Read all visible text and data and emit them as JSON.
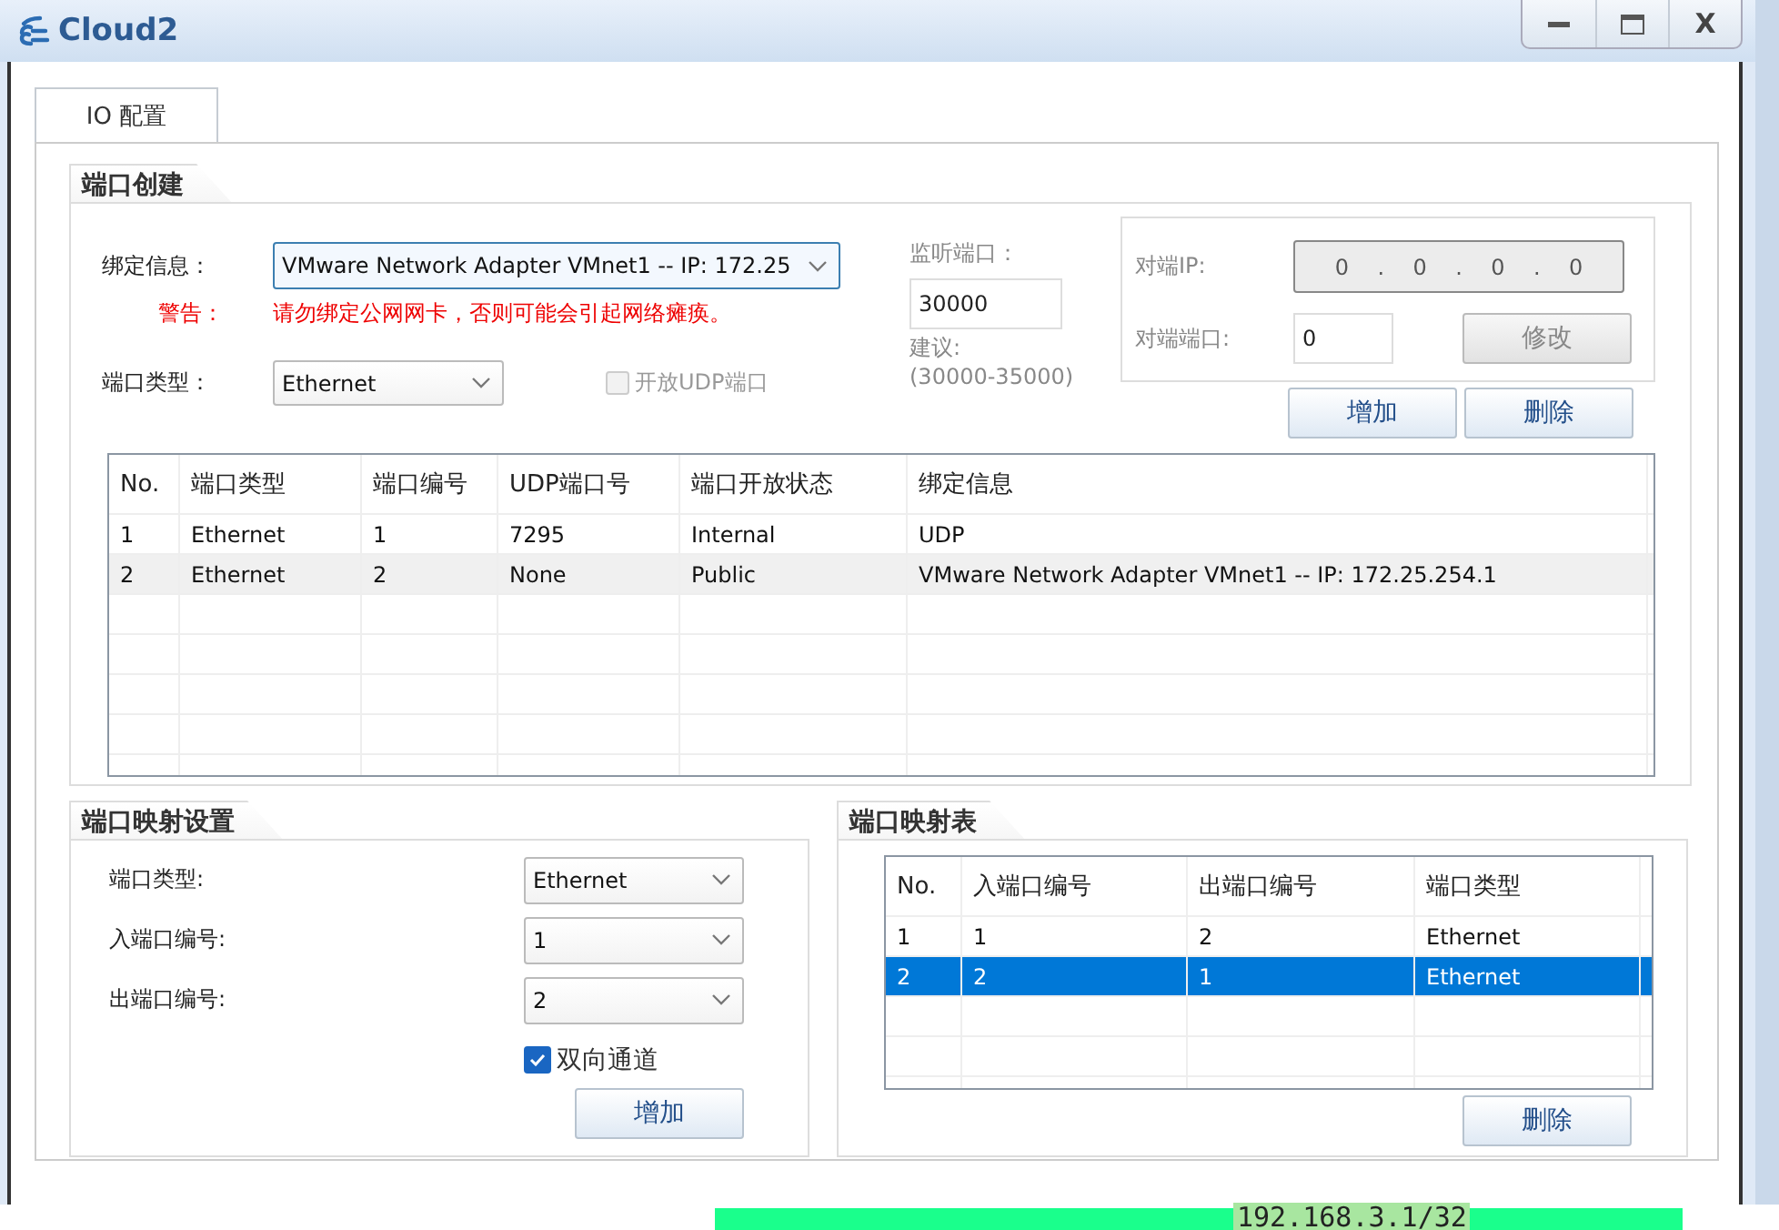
{
  "window": {
    "title": "Cloud2",
    "close_glyph": "X"
  },
  "tabs": [
    {
      "label": "IO 配置",
      "selected": true
    }
  ],
  "port_creation": {
    "title": "端口创建",
    "binding_label": "绑定信息：",
    "binding_value": "VMware Network Adapter VMnet1 -- IP: 172.25",
    "warning_label": "警告：",
    "warning_text": "请勿绑定公网网卡，否则可能会引起网络瘫痪。",
    "port_type_label": "端口类型：",
    "port_type_value": "Ethernet",
    "udp_checkbox": {
      "label": "开放UDP端口",
      "checked": false,
      "disabled": true
    },
    "listen": {
      "label": "监听端口：",
      "value": "30000",
      "suggest_label": "建议:",
      "suggest_range": "(30000-35000)",
      "disabled": true
    },
    "peer": {
      "ip_label": "对端IP:",
      "ip_octets": [
        "0",
        "0",
        "0",
        "0"
      ],
      "ip_separator": ".",
      "port_label": "对端端口:",
      "port_value": "0",
      "modify_button": {
        "label": "修改",
        "disabled": true
      },
      "disabled": true
    },
    "add_button": "增加",
    "delete_button": "删除",
    "table": {
      "columns": [
        "No.",
        "端口类型",
        "端口编号",
        "UDP端口号",
        "端口开放状态",
        "绑定信息"
      ],
      "rows": [
        {
          "cells": [
            "1",
            "Ethernet",
            "1",
            "7295",
            "Internal",
            "UDP"
          ],
          "selected": false
        },
        {
          "cells": [
            "2",
            "Ethernet",
            "2",
            "None",
            "Public",
            "VMware Network Adapter VMnet1 -- IP: 172.25.254.1"
          ],
          "selected": true
        }
      ]
    }
  },
  "port_mapping_settings": {
    "title": "端口映射设置",
    "fields": [
      {
        "label": "端口类型:",
        "value": "Ethernet"
      },
      {
        "label": "入端口编号:",
        "value": "1"
      },
      {
        "label": "出端口编号:",
        "value": "2"
      }
    ],
    "bidirectional": {
      "label": "双向通道",
      "checked": true
    },
    "add_button": "增加"
  },
  "port_mapping_table": {
    "title": "端口映射表",
    "table": {
      "columns": [
        "No.",
        "入端口编号",
        "出端口编号",
        "端口类型"
      ],
      "rows": [
        {
          "cells": [
            "1",
            "1",
            "2",
            "Ethernet"
          ],
          "selected": false
        },
        {
          "cells": [
            "2",
            "2",
            "1",
            "Ethernet"
          ],
          "selected": true
        }
      ]
    },
    "delete_button": "删除"
  },
  "background": {
    "address": "192.168.3.1/32"
  }
}
